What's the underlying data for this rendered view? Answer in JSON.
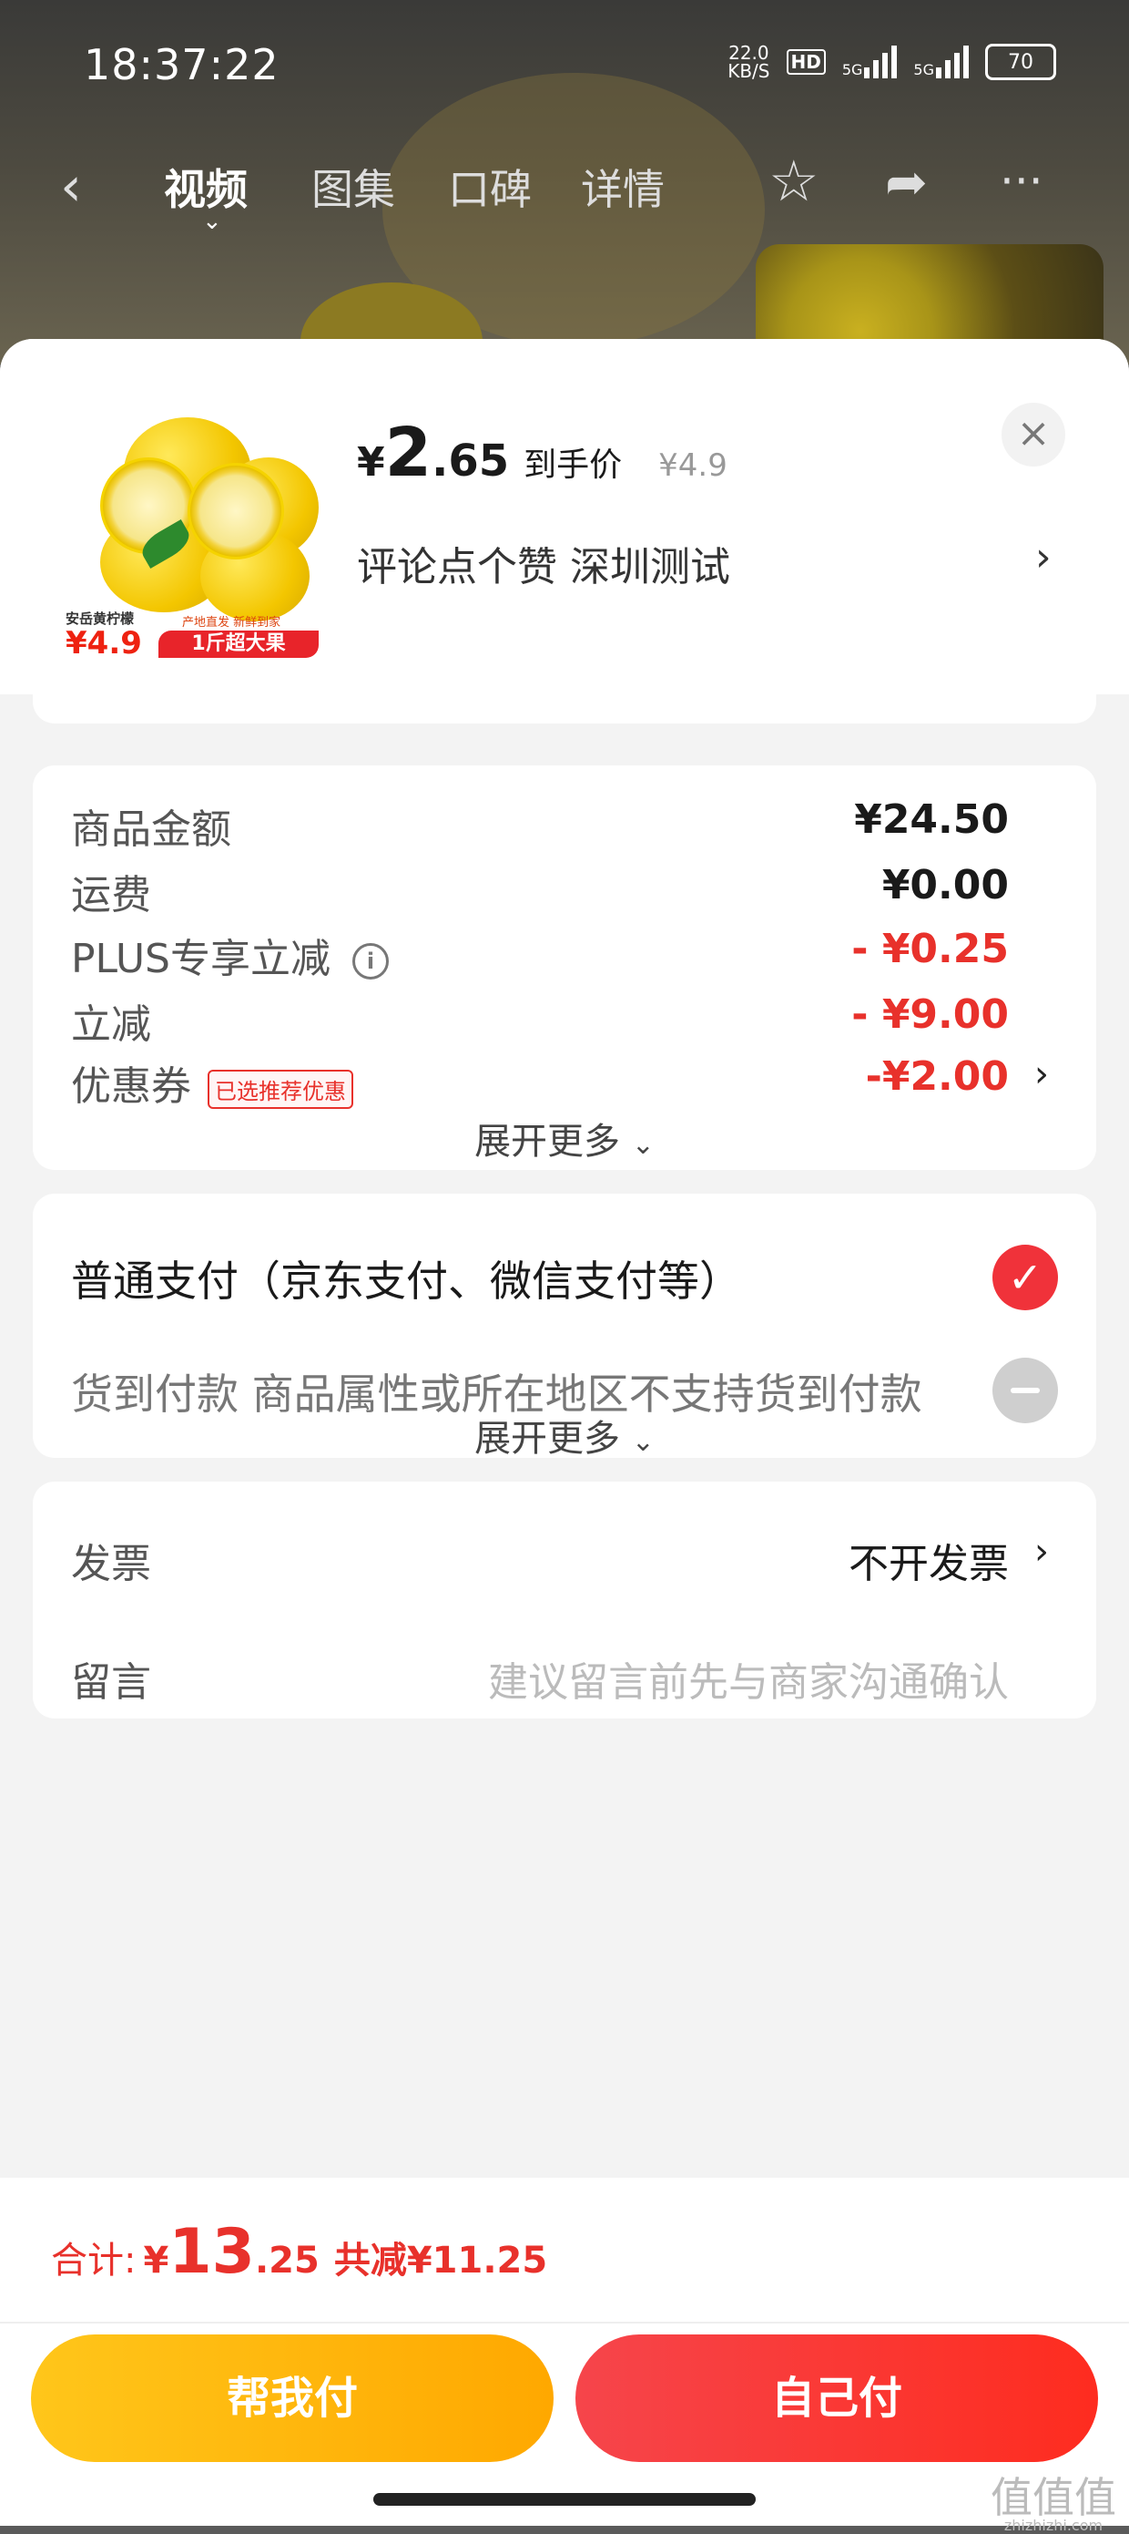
{
  "status_bar": {
    "time": "18:37:22",
    "speed_value": "22.0",
    "speed_unit": "KB/S",
    "hd": "HD",
    "net1": "5G",
    "net2": "5G",
    "battery": "70"
  },
  "nav": {
    "tabs": [
      "视频",
      "图集",
      "口碑",
      "详情"
    ]
  },
  "product": {
    "price_currency": "¥",
    "price_int": "2",
    "price_dec": ".65",
    "price_label": "到手价",
    "original_price": "¥4.9",
    "spec": "评论点个赞  深圳测试",
    "image_text": {
      "name": "安岳黄柠檬",
      "tag": "产地直发  新鲜到家",
      "price": "¥4.9",
      "ribbon": "1斤超大果"
    }
  },
  "summary": {
    "items": [
      {
        "label": "商品金额",
        "value": "¥24.50"
      },
      {
        "label": "运费",
        "value": "¥0.00"
      },
      {
        "label": "PLUS专享立减",
        "value": "- ¥0.25"
      },
      {
        "label": "立减",
        "value": "- ¥9.00"
      },
      {
        "label": "优惠券",
        "badge": "已选推荐优惠",
        "value": "-¥2.00"
      }
    ],
    "expand": "展开更多"
  },
  "payment": {
    "option1": "普通支付（京东支付、微信支付等）",
    "option2": "货到付款 商品属性或所在地区不支持货到付款",
    "expand": "展开更多"
  },
  "invoice": {
    "label": "发票",
    "value": "不开发票"
  },
  "message": {
    "label": "留言",
    "placeholder": "建议留言前先与商家沟通确认"
  },
  "footer": {
    "total_label": "合计:",
    "currency": "¥",
    "total_int": "13",
    "total_dec": ".25",
    "reduction": "共减¥11.25",
    "help_pay": "帮我付",
    "self_pay": "自己付"
  },
  "watermark": {
    "main": "值值值",
    "sub": "zhizhizhi.com"
  },
  "colors": {
    "accent_red": "#e8312b",
    "help_button": "#ffb300",
    "self_button": "#f6362f"
  }
}
